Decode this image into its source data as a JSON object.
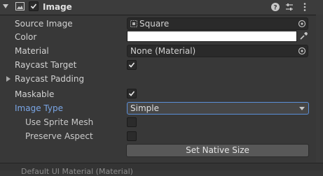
{
  "header": {
    "title": "Image",
    "icons": [
      "image-component-icon",
      "help-icon",
      "presets-icon",
      "more-icon"
    ]
  },
  "fields": {
    "source_image": {
      "label": "Source Image",
      "value": "Square"
    },
    "color": {
      "label": "Color",
      "value": "#ffffff"
    },
    "material": {
      "label": "Material",
      "value": "None (Material)"
    },
    "raycast_target": {
      "label": "Raycast Target",
      "checked": true
    },
    "raycast_padding": {
      "label": "Raycast Padding"
    },
    "maskable": {
      "label": "Maskable",
      "checked": true
    },
    "image_type": {
      "label": "Image Type",
      "value": "Simple"
    },
    "use_sprite_mesh": {
      "label": "Use Sprite Mesh",
      "checked": false
    },
    "preserve_aspect": {
      "label": "Preserve Aspect",
      "checked": false
    }
  },
  "buttons": {
    "set_native_size": "Set Native Size"
  },
  "footer": {
    "text": "Default UI Material (Material)"
  },
  "colors": {
    "accent": "#7aa6e6",
    "focus_border": "#5b8fd8",
    "background": "#383838"
  }
}
